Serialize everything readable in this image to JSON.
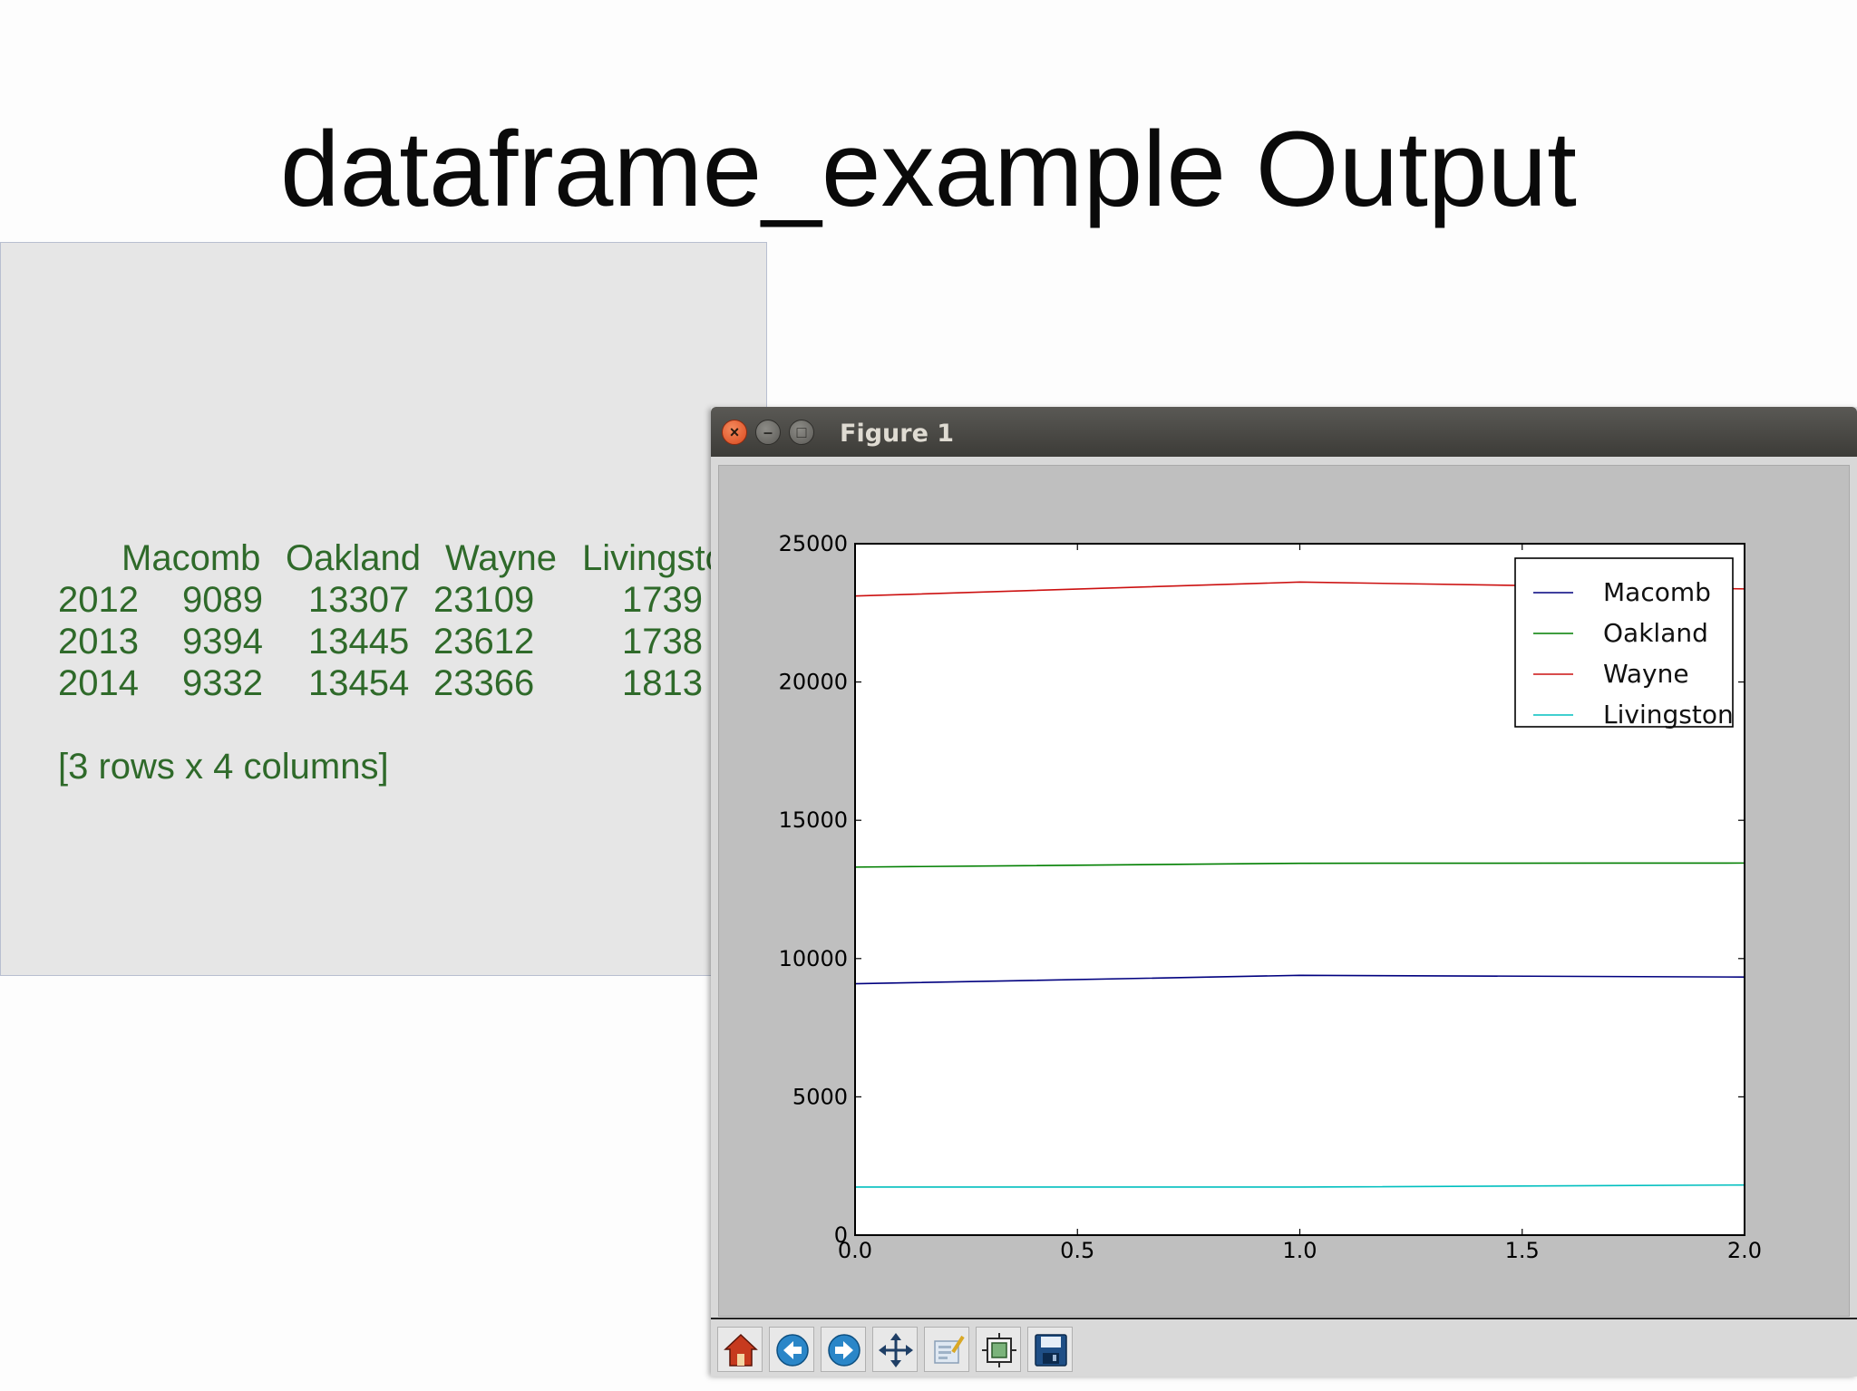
{
  "slide": {
    "title": "dataframe_example Output"
  },
  "console": {
    "columns": [
      "Macomb",
      "Oakland",
      "Wayne",
      "Livingston"
    ],
    "rows": [
      {
        "index": "2012",
        "cells": [
          "9089",
          "13307",
          "23109",
          "1739"
        ]
      },
      {
        "index": "2013",
        "cells": [
          "9394",
          "13445",
          "23612",
          "1738"
        ]
      },
      {
        "index": "2014",
        "cells": [
          "9332",
          "13454",
          "23366",
          "1813"
        ]
      }
    ],
    "footer": "[3 rows x 4 columns]"
  },
  "figure_window": {
    "title": "Figure 1",
    "buttons": {
      "close": "×",
      "minimize": "–",
      "maximize": "□"
    },
    "toolbar": [
      "home-icon",
      "back-icon",
      "forward-icon",
      "pan-icon",
      "zoom-icon",
      "subplots-icon",
      "save-icon"
    ]
  },
  "chart_data": {
    "type": "line",
    "x": [
      0.0,
      1.0,
      2.0
    ],
    "series": [
      {
        "name": "Macomb",
        "values": [
          9089,
          9394,
          9332
        ],
        "color": "#00007f"
      },
      {
        "name": "Oakland",
        "values": [
          13307,
          13445,
          13454
        ],
        "color": "#007f00"
      },
      {
        "name": "Wayne",
        "values": [
          23109,
          23612,
          23366
        ],
        "color": "#cc1010"
      },
      {
        "name": "Livingston",
        "values": [
          1739,
          1738,
          1813
        ],
        "color": "#00bfbf"
      }
    ],
    "xlim": [
      0.0,
      2.0
    ],
    "ylim": [
      0,
      25000
    ],
    "xticks": [
      "0.0",
      "0.5",
      "1.0",
      "1.5",
      "2.0"
    ],
    "yticks": [
      "0",
      "5000",
      "10000",
      "15000",
      "20000",
      "25000"
    ],
    "legend": "top-right",
    "grid": false,
    "title": "",
    "xlabel": "",
    "ylabel": ""
  }
}
